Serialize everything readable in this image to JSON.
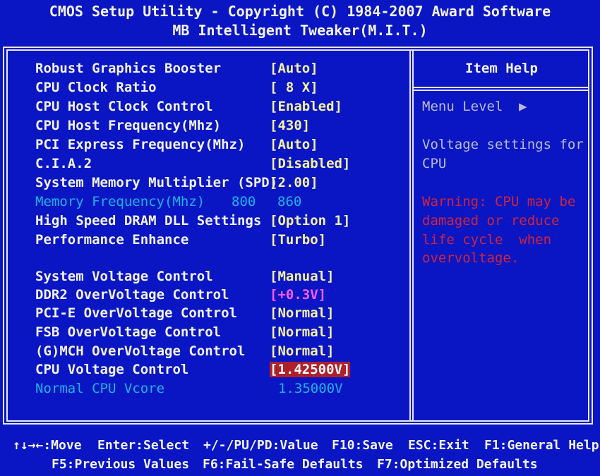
{
  "header": {
    "line1": "CMOS Setup Utility - Copyright (C) 1984-2007 Award Software",
    "line2": "MB Intelligent Tweaker(M.I.T.)"
  },
  "items": [
    {
      "label": "Robust Graphics Booster",
      "value": "[Auto]"
    },
    {
      "label": "CPU Clock Ratio",
      "value": "[ 8 X]"
    },
    {
      "label": "CPU Host Clock Control",
      "value": "[Enabled]"
    },
    {
      "label": "CPU Host Frequency(Mhz)",
      "value": "[430]"
    },
    {
      "label": "PCI Express Frequency(Mhz)",
      "value": "[Auto]"
    },
    {
      "label": "C.I.A.2",
      "value": "[Disabled]"
    },
    {
      "label": "System Memory Multiplier (SPD)",
      "value": "[2.00]"
    },
    {
      "label": "Memory Frequency(Mhz)",
      "value": "800",
      "value2": "860"
    },
    {
      "label": "High Speed DRAM DLL Settings",
      "value": "[Option 1]"
    },
    {
      "label": "Performance Enhance",
      "value": "[Turbo]"
    },
    {
      "label": "System Voltage Control",
      "value": "[Manual]"
    },
    {
      "label": "DDR2 OverVoltage Control",
      "value": "[+0.3V]"
    },
    {
      "label": "PCI-E OverVoltage Control",
      "value": "[Normal]"
    },
    {
      "label": "FSB OverVoltage Control",
      "value": "[Normal]"
    },
    {
      "label": "(G)MCH OverVoltage Control",
      "value": "[Normal]"
    },
    {
      "label": "CPU Voltage Control",
      "value": "[1.42500V]"
    },
    {
      "label": "Normal CPU Vcore",
      "value": "1.35000V"
    }
  ],
  "help": {
    "title": "Item Help",
    "menu_level": "Menu Level",
    "menu_level_arrow": "▶",
    "description": [
      "Voltage settings for",
      "CPU"
    ],
    "warning": [
      "Warning: CPU may be",
      "damaged or reduce",
      "life cycle  when",
      "overvoltage."
    ]
  },
  "footer": {
    "move": "↑↓→←:Move",
    "select": "Enter:Select",
    "value": "+/-/PU/PD:Value",
    "save": "F10:Save",
    "exit": "ESC:Exit",
    "general_help": "F1:General Help",
    "previous": "F5:Previous Values",
    "failsafe": "F6:Fail-Safe Defaults",
    "optimized": "F7:Optimized Defaults"
  },
  "colors": {
    "background": "#0a16c4",
    "value_yellow": "#f5f0a8",
    "disabled_cyan": "#18b4e8",
    "highlight_red": "#b0202a",
    "warning_red": "#d0243a"
  }
}
